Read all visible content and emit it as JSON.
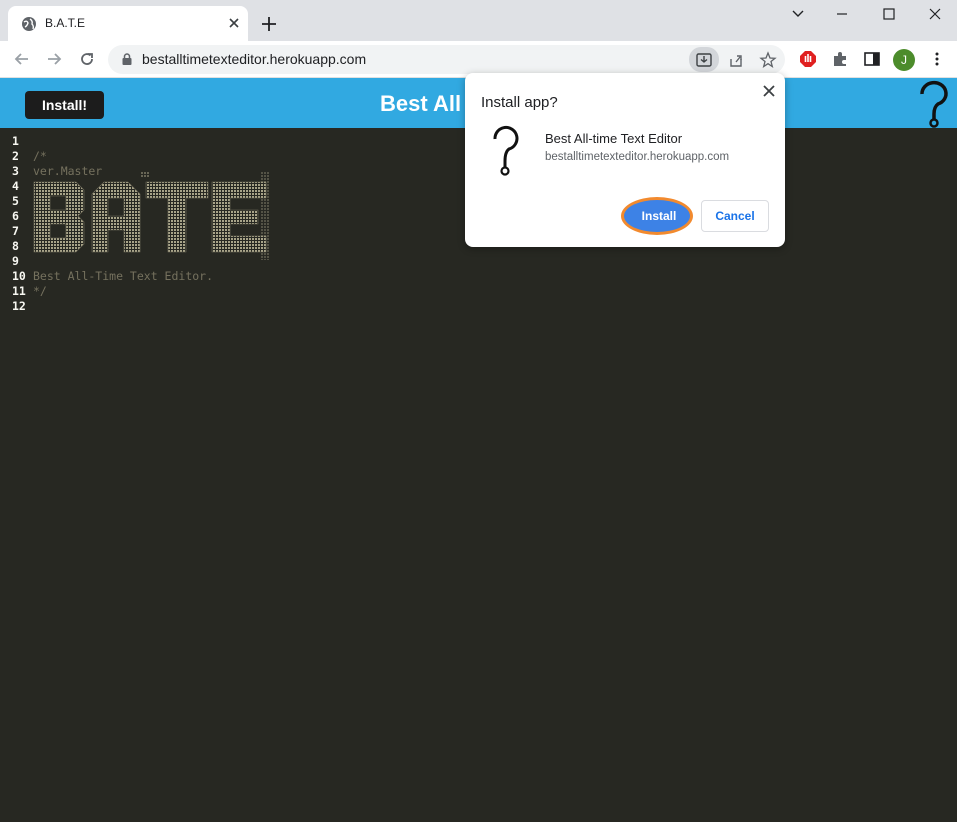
{
  "browser": {
    "tab_title": "B.A.T.E",
    "url": "bestalltimetexteditor.herokuapp.com",
    "avatar_letter": "J"
  },
  "app": {
    "install_button_label": "Install!",
    "header_title": "Best All"
  },
  "editor": {
    "lines": [
      {
        "num": "1",
        "text": ""
      },
      {
        "num": "2",
        "text": "/*"
      },
      {
        "num": "3",
        "text": "ver.Master"
      },
      {
        "num": "4",
        "text": ""
      },
      {
        "num": "5",
        "text": ""
      },
      {
        "num": "6",
        "text": ""
      },
      {
        "num": "7",
        "text": ""
      },
      {
        "num": "8",
        "text": ""
      },
      {
        "num": "9",
        "text": ""
      },
      {
        "num": "10",
        "text": "Best All-Time Text Editor."
      },
      {
        "num": "11",
        "text": "*/"
      },
      {
        "num": "12",
        "text": ""
      }
    ],
    "banner_letters": "BATE"
  },
  "dialog": {
    "title": "Install app?",
    "app_name": "Best All-time Text Editor",
    "origin": "bestalltimetexteditor.herokuapp.com",
    "install_label": "Install",
    "cancel_label": "Cancel",
    "highlight_color": "#f28a2e"
  }
}
